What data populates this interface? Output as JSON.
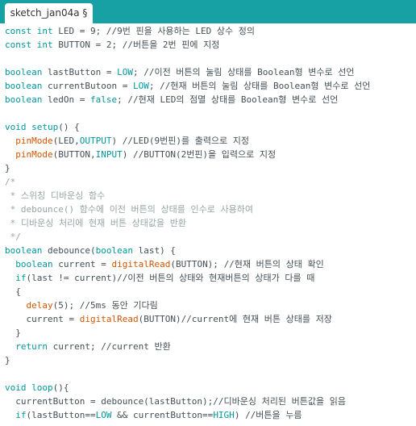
{
  "tab": {
    "label": "sketch_jan04a §"
  },
  "code": {
    "lines": [
      [
        {
          "t": "tp",
          "v": "const int"
        },
        {
          "t": "p",
          "v": " LED = 9; "
        },
        {
          "t": "lc",
          "v": "//9번 핀을 사용하는 LED 상수 정의"
        }
      ],
      [
        {
          "t": "tp",
          "v": "const int"
        },
        {
          "t": "p",
          "v": " BUTTON = 2; "
        },
        {
          "t": "lc",
          "v": "//버튼을 2번 핀에 지정"
        }
      ],
      [],
      [
        {
          "t": "tp",
          "v": "boolean"
        },
        {
          "t": "p",
          "v": " lastButton = "
        },
        {
          "t": "lit",
          "v": "LOW"
        },
        {
          "t": "p",
          "v": "; "
        },
        {
          "t": "lc",
          "v": "//이전 버튼의 눌림 상태를 Boolean형 변수로 선언"
        }
      ],
      [
        {
          "t": "tp",
          "v": "boolean"
        },
        {
          "t": "p",
          "v": " currentButoon = "
        },
        {
          "t": "lit",
          "v": "LOW"
        },
        {
          "t": "p",
          "v": "; "
        },
        {
          "t": "lc",
          "v": "//현재 버튼의 눌림 상태를 Boolean형 변수로 선언"
        }
      ],
      [
        {
          "t": "tp",
          "v": "boolean"
        },
        {
          "t": "p",
          "v": " ledOn = "
        },
        {
          "t": "lit",
          "v": "false"
        },
        {
          "t": "p",
          "v": "; "
        },
        {
          "t": "lc",
          "v": "//현재 LED의 점멸 상태를 Boolean형 변수로 선언"
        }
      ],
      [],
      [
        {
          "t": "tp",
          "v": "void"
        },
        {
          "t": "p",
          "v": " "
        },
        {
          "t": "kw",
          "v": "setup"
        },
        {
          "t": "p",
          "v": "() {"
        }
      ],
      [
        {
          "t": "p",
          "v": "  "
        },
        {
          "t": "fn",
          "v": "pinMode"
        },
        {
          "t": "p",
          "v": "(LED,"
        },
        {
          "t": "lit",
          "v": "OUTPUT"
        },
        {
          "t": "p",
          "v": ") "
        },
        {
          "t": "lc",
          "v": "//LED(9번핀)를 출력으로 지정"
        }
      ],
      [
        {
          "t": "p",
          "v": "  "
        },
        {
          "t": "fn",
          "v": "pinMode"
        },
        {
          "t": "p",
          "v": "(BUTTON,"
        },
        {
          "t": "lit",
          "v": "INPUT"
        },
        {
          "t": "p",
          "v": ") "
        },
        {
          "t": "lc",
          "v": "//BUTTON(2번핀)을 입력으로 지정"
        }
      ],
      [
        {
          "t": "p",
          "v": "}"
        }
      ],
      [
        {
          "t": "cm",
          "v": "/*"
        }
      ],
      [
        {
          "t": "cm",
          "v": " * 스위칭 디바운싱 함수"
        }
      ],
      [
        {
          "t": "cm",
          "v": " * debounce() 함수에 이전 버튼의 상태를 인수로 사용하여"
        }
      ],
      [
        {
          "t": "cm",
          "v": " * 디바운싱 처리에 현재 버튼 상태값을 반환"
        }
      ],
      [
        {
          "t": "cm",
          "v": " */"
        }
      ],
      [
        {
          "t": "tp",
          "v": "boolean"
        },
        {
          "t": "p",
          "v": " debounce("
        },
        {
          "t": "tp",
          "v": "boolean"
        },
        {
          "t": "p",
          "v": " last) {"
        }
      ],
      [
        {
          "t": "p",
          "v": "  "
        },
        {
          "t": "tp",
          "v": "boolean"
        },
        {
          "t": "p",
          "v": " current = "
        },
        {
          "t": "fn",
          "v": "digitalRead"
        },
        {
          "t": "p",
          "v": "(BUTTON); "
        },
        {
          "t": "lc",
          "v": "//현재 버튼의 상태 확인"
        }
      ],
      [
        {
          "t": "p",
          "v": "  "
        },
        {
          "t": "kw",
          "v": "if"
        },
        {
          "t": "p",
          "v": "(last != current)"
        },
        {
          "t": "lc",
          "v": "//이전 버튼의 상태와 현재버튼의 상태가 다를 때"
        }
      ],
      [
        {
          "t": "p",
          "v": "  {"
        }
      ],
      [
        {
          "t": "p",
          "v": "    "
        },
        {
          "t": "fn",
          "v": "delay"
        },
        {
          "t": "p",
          "v": "(5); "
        },
        {
          "t": "lc",
          "v": "//5ms 동안 기다림"
        }
      ],
      [
        {
          "t": "p",
          "v": "    current = "
        },
        {
          "t": "fn",
          "v": "digitalRead"
        },
        {
          "t": "p",
          "v": "(BUTTON)"
        },
        {
          "t": "lc",
          "v": "//current에 현재 버튼 상태를 저장"
        }
      ],
      [
        {
          "t": "p",
          "v": "  }"
        }
      ],
      [
        {
          "t": "p",
          "v": "  "
        },
        {
          "t": "kw",
          "v": "return"
        },
        {
          "t": "p",
          "v": " current; "
        },
        {
          "t": "lc",
          "v": "//current 반환"
        }
      ],
      [
        {
          "t": "p",
          "v": "}"
        }
      ],
      [],
      [
        {
          "t": "tp",
          "v": "void"
        },
        {
          "t": "p",
          "v": " "
        },
        {
          "t": "kw",
          "v": "loop"
        },
        {
          "t": "p",
          "v": "(){"
        }
      ],
      [
        {
          "t": "p",
          "v": "  currentButton = debounce(lastButton);"
        },
        {
          "t": "lc",
          "v": "//디바운싱 처리된 버튼값을 읽음"
        }
      ],
      [
        {
          "t": "p",
          "v": "  "
        },
        {
          "t": "kw",
          "v": "if"
        },
        {
          "t": "p",
          "v": "(lastButton=="
        },
        {
          "t": "lit",
          "v": "LOW"
        },
        {
          "t": "p",
          "v": " && currentButton=="
        },
        {
          "t": "lit",
          "v": "HIGH"
        },
        {
          "t": "p",
          "v": ") "
        },
        {
          "t": "lc",
          "v": "//버튼을 누름"
        }
      ]
    ]
  }
}
